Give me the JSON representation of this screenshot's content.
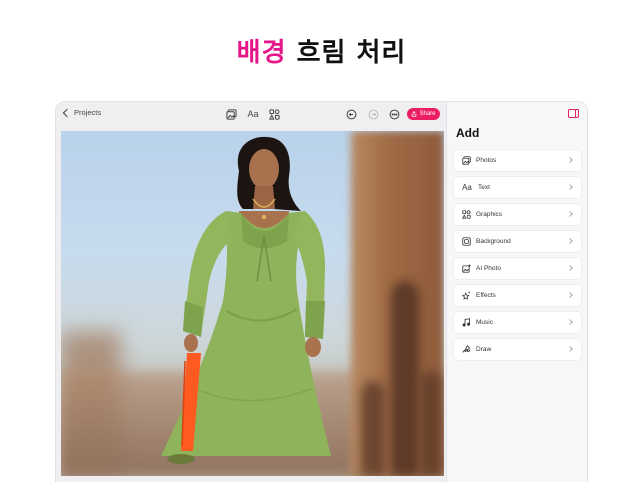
{
  "headline": {
    "accent": "배경",
    "rest": " 흐림 처리"
  },
  "toolbar": {
    "back_label": "Projects",
    "text_icon_label": "Aa",
    "share_label": "Share",
    "accent_color": "#ea1e63"
  },
  "panel": {
    "title": "Add",
    "items": [
      {
        "label": "Photos",
        "icon": "photos-icon"
      },
      {
        "label": "Text",
        "icon": "text-icon",
        "glyph": "Aa"
      },
      {
        "label": "Graphics",
        "icon": "graphics-icon"
      },
      {
        "label": "Background",
        "icon": "background-icon"
      },
      {
        "label": "AI Photo",
        "icon": "ai-photo-icon"
      },
      {
        "label": "Effects",
        "icon": "effects-icon"
      },
      {
        "label": "Music",
        "icon": "music-icon"
      },
      {
        "label": "Draw",
        "icon": "draw-icon"
      }
    ]
  }
}
